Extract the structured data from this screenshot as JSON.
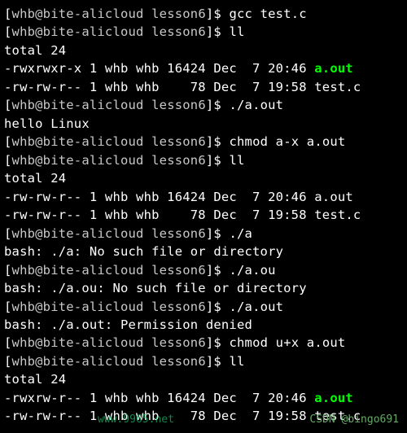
{
  "prompt": {
    "user": "whb",
    "host": "bite-alicloud",
    "dir": "lesson6"
  },
  "lines": [
    {
      "type": "prompt",
      "cmd": "gcc test.c"
    },
    {
      "type": "prompt",
      "cmd": "ll"
    },
    {
      "type": "plain",
      "text": "total 24"
    },
    {
      "type": "ls",
      "perms": "-rwxrwxr-x",
      "links": "1",
      "user": "whb",
      "group": "whb",
      "size": "16424",
      "date": "Dec  7 20:46",
      "name": "a.out",
      "exec": true
    },
    {
      "type": "ls",
      "perms": "-rw-rw-r--",
      "links": "1",
      "user": "whb",
      "group": "whb",
      "size": "   78",
      "date": "Dec  7 19:58",
      "name": "test.c",
      "exec": false
    },
    {
      "type": "prompt",
      "cmd": "./a.out"
    },
    {
      "type": "plain",
      "text": "hello Linux"
    },
    {
      "type": "prompt",
      "cmd": "chmod a-x a.out"
    },
    {
      "type": "prompt",
      "cmd": "ll"
    },
    {
      "type": "plain",
      "text": "total 24"
    },
    {
      "type": "ls",
      "perms": "-rw-rw-r--",
      "links": "1",
      "user": "whb",
      "group": "whb",
      "size": "16424",
      "date": "Dec  7 20:46",
      "name": "a.out",
      "exec": false
    },
    {
      "type": "ls",
      "perms": "-rw-rw-r--",
      "links": "1",
      "user": "whb",
      "group": "whb",
      "size": "   78",
      "date": "Dec  7 19:58",
      "name": "test.c",
      "exec": false
    },
    {
      "type": "prompt",
      "cmd": "./a"
    },
    {
      "type": "plain",
      "text": "bash: ./a: No such file or directory"
    },
    {
      "type": "prompt",
      "cmd": "./a.ou"
    },
    {
      "type": "plain",
      "text": "bash: ./a.ou: No such file or directory"
    },
    {
      "type": "prompt",
      "cmd": "./a.out"
    },
    {
      "type": "plain",
      "text": "bash: ./a.out: Permission denied"
    },
    {
      "type": "prompt",
      "cmd": "chmod u+x a.out"
    },
    {
      "type": "prompt",
      "cmd": "ll"
    },
    {
      "type": "plain",
      "text": "total 24"
    },
    {
      "type": "ls",
      "perms": "-rwxrw-r--",
      "links": "1",
      "user": "whb",
      "group": "whb",
      "size": "16424",
      "date": "Dec  7 20:46",
      "name": "a.out",
      "exec": true
    },
    {
      "type": "ls",
      "perms": "-rw-rw-r--",
      "links": "1",
      "user": "whb",
      "group": "whb",
      "size": "   78",
      "date": "Dec  7 19:58",
      "name": "test.c",
      "exec": false
    }
  ],
  "watermarks": {
    "top": "",
    "left": "www.9965.net",
    "right": "CSDN @bingo691"
  }
}
